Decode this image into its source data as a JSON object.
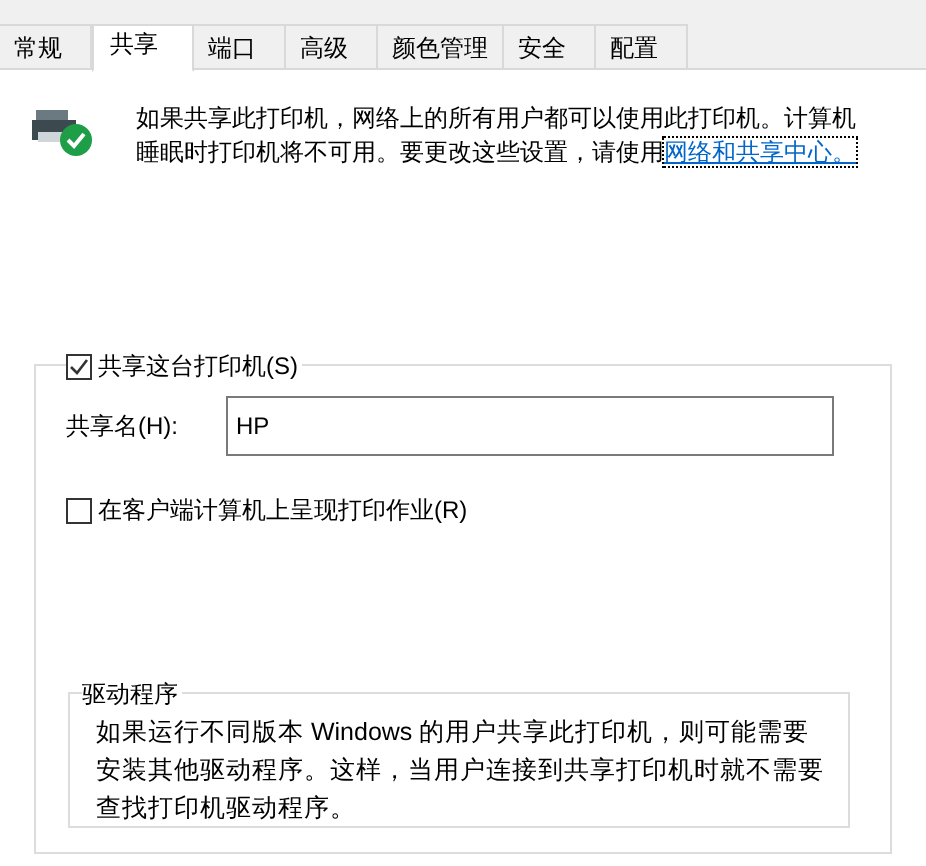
{
  "tabs": [
    {
      "label": "常规",
      "selected": false
    },
    {
      "label": "共享",
      "selected": true
    },
    {
      "label": "端口",
      "selected": false
    },
    {
      "label": "高级",
      "selected": false
    },
    {
      "label": "颜色管理",
      "selected": false
    },
    {
      "label": "安全",
      "selected": false
    },
    {
      "label": "配置",
      "selected": false
    }
  ],
  "info": {
    "text": "如果共享此打印机，网络上的所有用户都可以使用此打印机。计算机睡眠时打印机将不可用。要更改这些设置，请使用",
    "link": "网络和共享中心。"
  },
  "share_checkbox": {
    "label": "共享这台打印机(S)",
    "checked": true
  },
  "share_name": {
    "label": "共享名(H):",
    "value": "HP"
  },
  "render_checkbox": {
    "label": "在客户端计算机上呈现打印作业(R)",
    "checked": false
  },
  "drivers": {
    "title": "驱动程序",
    "text": "如果运行不同版本 Windows 的用户共享此打印机，则可能需要安装其他驱动程序。这样，当用户连接到共享打印机时就不需要查找打印机驱动程序。"
  }
}
